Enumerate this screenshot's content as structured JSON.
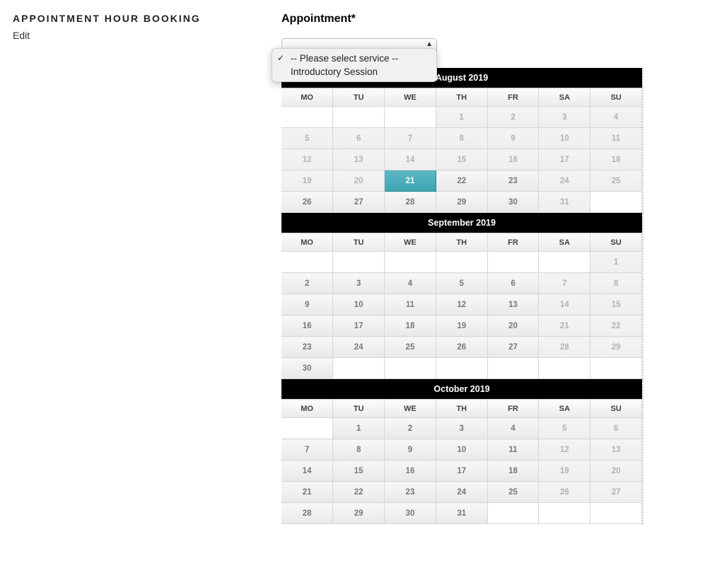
{
  "page": {
    "title": "APPOINTMENT HOUR BOOKING",
    "edit_label": "Edit"
  },
  "field": {
    "label": "Appointment*"
  },
  "dropdown": {
    "options": [
      {
        "label": "-- Please select service --",
        "selected": true
      },
      {
        "label": "Introductory Session",
        "selected": false
      }
    ]
  },
  "weekdays": [
    "MO",
    "TU",
    "WE",
    "TH",
    "FR",
    "SA",
    "SU"
  ],
  "nav": {
    "prev": "◄"
  },
  "months": [
    {
      "title": "August 2019",
      "show_prev": true,
      "weeks": [
        [
          null,
          null,
          null,
          {
            "n": 1,
            "d": true
          },
          {
            "n": 2,
            "d": true
          },
          {
            "n": 3,
            "d": true
          },
          {
            "n": 4,
            "d": true
          }
        ],
        [
          {
            "n": 5,
            "d": true
          },
          {
            "n": 6,
            "d": true
          },
          {
            "n": 7,
            "d": true
          },
          {
            "n": 8,
            "d": true
          },
          {
            "n": 9,
            "d": true
          },
          {
            "n": 10,
            "d": true
          },
          {
            "n": 11,
            "d": true
          }
        ],
        [
          {
            "n": 12,
            "d": true
          },
          {
            "n": 13,
            "d": true
          },
          {
            "n": 14,
            "d": true
          },
          {
            "n": 15,
            "d": true
          },
          {
            "n": 16,
            "d": true
          },
          {
            "n": 17,
            "d": true
          },
          {
            "n": 18,
            "d": true
          }
        ],
        [
          {
            "n": 19,
            "d": true
          },
          {
            "n": 20,
            "d": true
          },
          {
            "n": 21,
            "active": true
          },
          {
            "n": 22
          },
          {
            "n": 23
          },
          {
            "n": 24,
            "d": true
          },
          {
            "n": 25,
            "d": true
          }
        ],
        [
          {
            "n": 26
          },
          {
            "n": 27
          },
          {
            "n": 28
          },
          {
            "n": 29
          },
          {
            "n": 30
          },
          {
            "n": 31,
            "d": true
          },
          null
        ]
      ]
    },
    {
      "title": "September 2019",
      "show_prev": false,
      "weeks": [
        [
          null,
          null,
          null,
          null,
          null,
          null,
          {
            "n": 1,
            "d": true
          }
        ],
        [
          {
            "n": 2
          },
          {
            "n": 3
          },
          {
            "n": 4
          },
          {
            "n": 5
          },
          {
            "n": 6
          },
          {
            "n": 7,
            "d": true
          },
          {
            "n": 8,
            "d": true
          }
        ],
        [
          {
            "n": 9
          },
          {
            "n": 10
          },
          {
            "n": 11
          },
          {
            "n": 12
          },
          {
            "n": 13
          },
          {
            "n": 14,
            "d": true
          },
          {
            "n": 15,
            "d": true
          }
        ],
        [
          {
            "n": 16
          },
          {
            "n": 17
          },
          {
            "n": 18
          },
          {
            "n": 19
          },
          {
            "n": 20
          },
          {
            "n": 21,
            "d": true
          },
          {
            "n": 22,
            "d": true
          }
        ],
        [
          {
            "n": 23
          },
          {
            "n": 24
          },
          {
            "n": 25
          },
          {
            "n": 26
          },
          {
            "n": 27
          },
          {
            "n": 28,
            "d": true
          },
          {
            "n": 29,
            "d": true
          }
        ],
        [
          {
            "n": 30
          },
          null,
          null,
          null,
          null,
          null,
          null
        ]
      ]
    },
    {
      "title": "October 2019",
      "show_prev": false,
      "weeks": [
        [
          null,
          {
            "n": 1
          },
          {
            "n": 2
          },
          {
            "n": 3
          },
          {
            "n": 4
          },
          {
            "n": 5,
            "d": true
          },
          {
            "n": 6,
            "d": true
          }
        ],
        [
          {
            "n": 7
          },
          {
            "n": 8
          },
          {
            "n": 9
          },
          {
            "n": 10
          },
          {
            "n": 11
          },
          {
            "n": 12,
            "d": true
          },
          {
            "n": 13,
            "d": true
          }
        ],
        [
          {
            "n": 14
          },
          {
            "n": 15
          },
          {
            "n": 16
          },
          {
            "n": 17
          },
          {
            "n": 18
          },
          {
            "n": 19,
            "d": true
          },
          {
            "n": 20,
            "d": true
          }
        ],
        [
          {
            "n": 21
          },
          {
            "n": 22
          },
          {
            "n": 23
          },
          {
            "n": 24
          },
          {
            "n": 25
          },
          {
            "n": 26,
            "d": true
          },
          {
            "n": 27,
            "d": true
          }
        ],
        [
          {
            "n": 28
          },
          {
            "n": 29
          },
          {
            "n": 30
          },
          {
            "n": 31
          },
          null,
          null,
          null
        ]
      ]
    }
  ]
}
